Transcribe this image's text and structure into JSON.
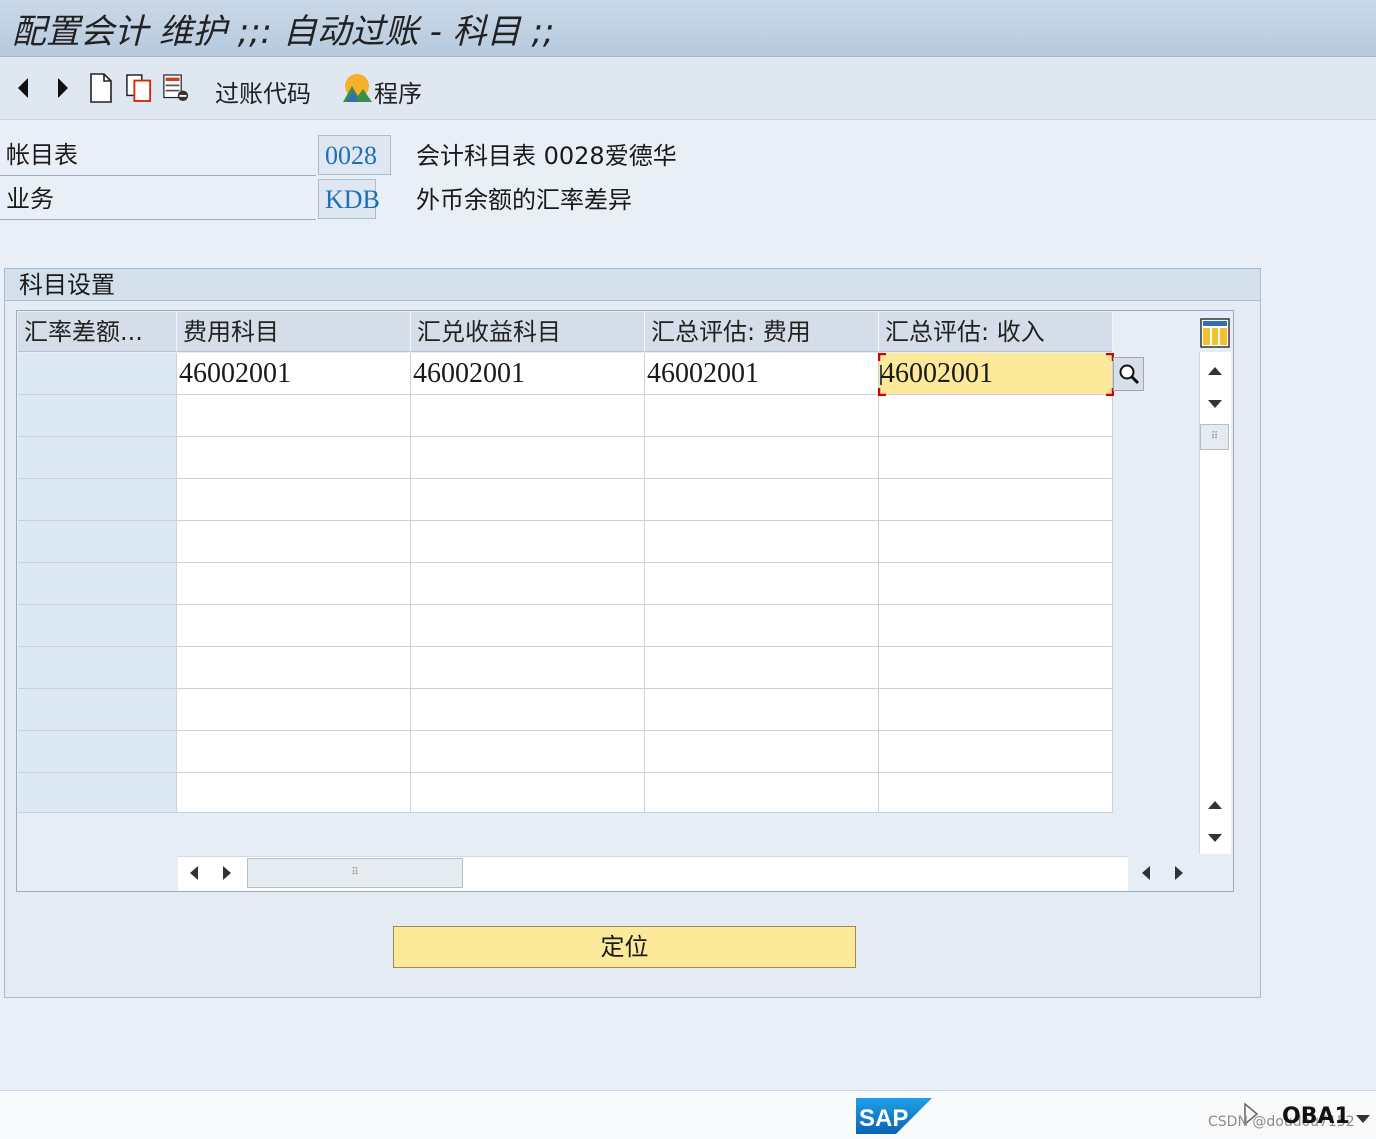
{
  "window": {
    "title": "配置会计 维护 ;;: 自动过账 - 科目 ;;"
  },
  "toolbar": {
    "icons": [
      "back-arrow-icon",
      "forward-arrow-icon",
      "new-document-icon",
      "copy-icon",
      "delete-rows-icon",
      "program-icon"
    ],
    "posting_key_label": "过账代码",
    "program_label": "程序"
  },
  "header": {
    "chart_of_accounts": {
      "label": "帐目表",
      "value": "0028",
      "description": "会计科目表 0028爱德华"
    },
    "transaction": {
      "label": "业务",
      "value": "KDB",
      "description": "外币余额的汇率差异"
    }
  },
  "account_settings": {
    "title": "科目设置",
    "columns": [
      "汇率差额...",
      "费用科目",
      "汇兑收益科目",
      "汇总评估: 费用",
      "汇总评估: 收入"
    ],
    "rows": [
      [
        "",
        "46002001",
        "46002001",
        "46002001",
        "46002001"
      ],
      [
        "",
        "",
        "",
        "",
        ""
      ],
      [
        "",
        "",
        "",
        "",
        ""
      ],
      [
        "",
        "",
        "",
        "",
        ""
      ],
      [
        "",
        "",
        "",
        "",
        ""
      ],
      [
        "",
        "",
        "",
        "",
        ""
      ],
      [
        "",
        "",
        "",
        "",
        ""
      ],
      [
        "",
        "",
        "",
        "",
        ""
      ],
      [
        "",
        "",
        "",
        "",
        ""
      ],
      [
        "",
        "",
        "",
        "",
        ""
      ],
      [
        "",
        "",
        "",
        "",
        ""
      ]
    ],
    "locate_button": "定位"
  },
  "statusbar": {
    "brand": "SAP",
    "transaction_code": "OBA1",
    "watermark": "CSDN @doudou7152"
  },
  "colors": {
    "title_bar": "#c9d8e8",
    "field_value_text": "#1f6fb5",
    "active_cell": "#fde99a",
    "button": "#fde99a",
    "sap_blue": "#1a7fd0"
  }
}
